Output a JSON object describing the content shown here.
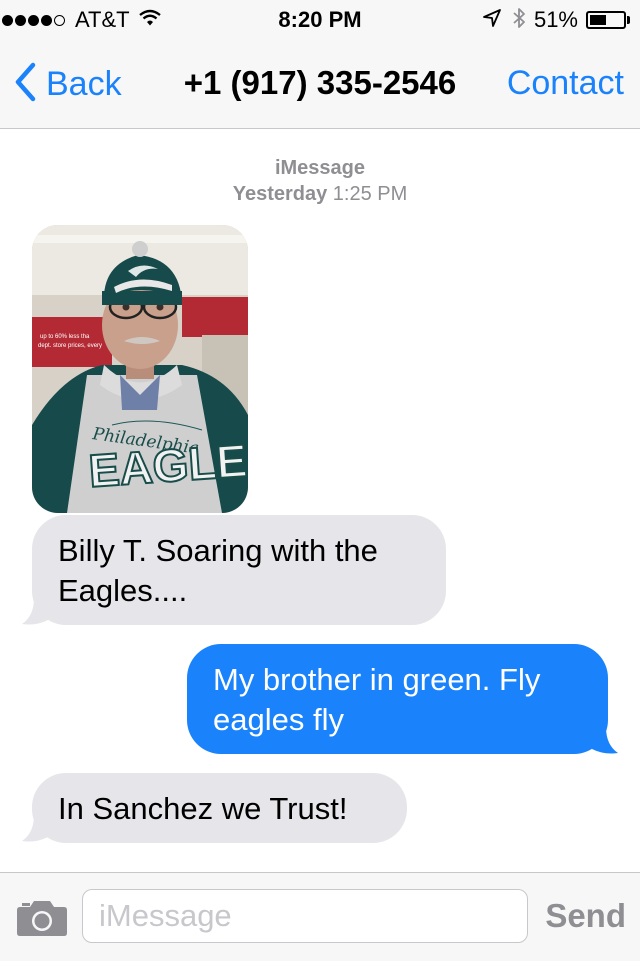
{
  "status_bar": {
    "carrier": "AT&T",
    "time": "8:20 PM",
    "battery": "51%",
    "battery_level": 0.51,
    "signal_bars": 4,
    "signal_max": 5
  },
  "nav": {
    "back_label": "Back",
    "title": "+1 (917) 335-2546",
    "contact_label": "Contact"
  },
  "thread": {
    "service": "iMessage",
    "day": "Yesterday",
    "time": "1:25 PM"
  },
  "messages": [
    {
      "direction": "incoming",
      "type": "photo"
    },
    {
      "direction": "incoming",
      "lines": [
        "Billy T. Soaring with the",
        "Eagles...."
      ]
    },
    {
      "direction": "outgoing",
      "lines": [
        "My brother in green. Fly",
        "eagles fly"
      ]
    },
    {
      "direction": "incoming",
      "lines": [
        "In Sanchez we Trust!"
      ]
    }
  ],
  "photo": {
    "jacket_text": "EAGLE",
    "script_text": "Philadelphia",
    "sign_lines": [
      "up to 60% less tha",
      "dept. store prices, every"
    ]
  },
  "input": {
    "placeholder": "iMessage",
    "value": "",
    "send_label": "Send"
  },
  "colors": {
    "accent": "#1a82fb",
    "incoming_bubble": "#e5e5ea",
    "outgoing_bubble": "#1a82fb",
    "secondary_text": "#8e8e93"
  },
  "icons": {
    "back": "chevron-left-icon",
    "camera": "camera-icon",
    "wifi": "wifi-icon",
    "location": "location-arrow-icon",
    "bluetooth": "bluetooth-icon",
    "battery": "battery-icon"
  }
}
